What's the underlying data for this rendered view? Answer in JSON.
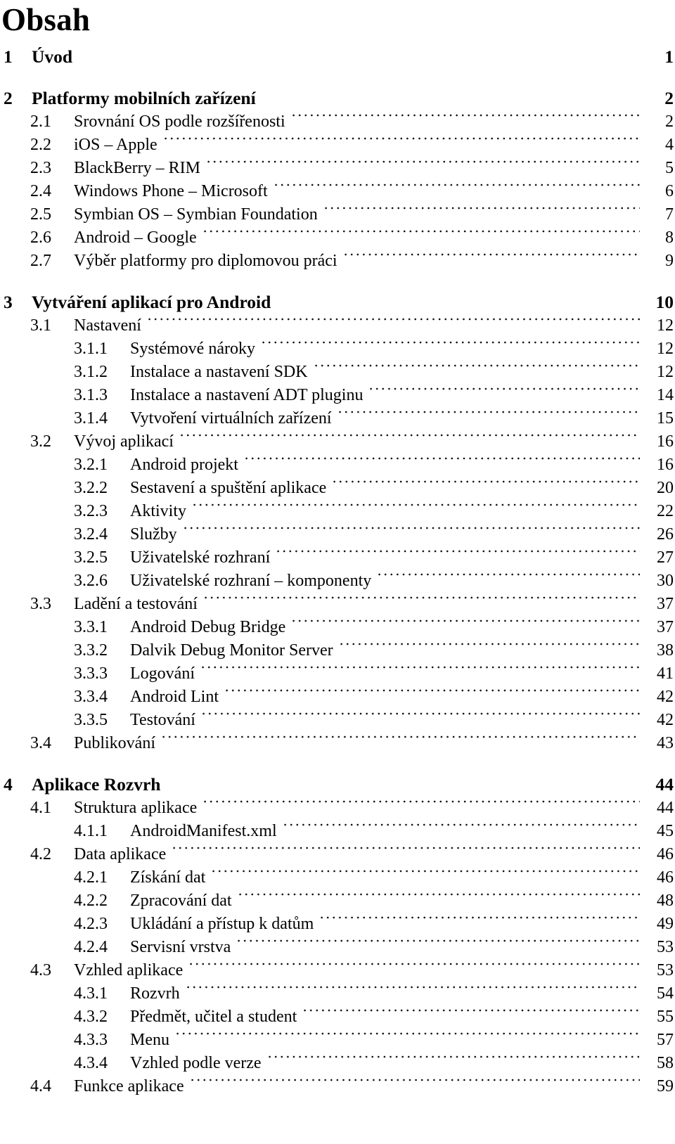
{
  "document": {
    "title": "Obsah",
    "language": "cs",
    "kind": "table-of-contents"
  },
  "toc": {
    "entries": [
      {
        "level": 1,
        "number": "1",
        "label": "Úvod",
        "page": "1",
        "leader": false
      },
      {
        "level": 1,
        "number": "2",
        "label": "Platformy mobilních zařízení",
        "page": "2",
        "leader": false
      },
      {
        "level": 2,
        "number": "2.1",
        "label": "Srovnání OS podle rozšířenosti",
        "page": "2",
        "leader": true
      },
      {
        "level": 2,
        "number": "2.2",
        "label": "iOS – Apple",
        "page": "4",
        "leader": true
      },
      {
        "level": 2,
        "number": "2.3",
        "label": "BlackBerry – RIM",
        "page": "5",
        "leader": true
      },
      {
        "level": 2,
        "number": "2.4",
        "label": "Windows Phone – Microsoft",
        "page": "6",
        "leader": true
      },
      {
        "level": 2,
        "number": "2.5",
        "label": "Symbian OS – Symbian Foundation",
        "page": "7",
        "leader": true
      },
      {
        "level": 2,
        "number": "2.6",
        "label": "Android – Google",
        "page": "8",
        "leader": true
      },
      {
        "level": 2,
        "number": "2.7",
        "label": "Výběr platformy pro diplomovou práci",
        "page": "9",
        "leader": true
      },
      {
        "level": 1,
        "number": "3",
        "label": "Vytváření aplikací pro Android",
        "page": "10",
        "leader": false
      },
      {
        "level": 2,
        "number": "3.1",
        "label": "Nastavení",
        "page": "12",
        "leader": true
      },
      {
        "level": 3,
        "number": "3.1.1",
        "label": "Systémové nároky",
        "page": "12",
        "leader": true
      },
      {
        "level": 3,
        "number": "3.1.2",
        "label": "Instalace a nastavení SDK",
        "page": "12",
        "leader": true
      },
      {
        "level": 3,
        "number": "3.1.3",
        "label": "Instalace a nastavení ADT pluginu",
        "page": "14",
        "leader": true
      },
      {
        "level": 3,
        "number": "3.1.4",
        "label": "Vytvoření virtuálních zařízení",
        "page": "15",
        "leader": true
      },
      {
        "level": 2,
        "number": "3.2",
        "label": "Vývoj aplikací",
        "page": "16",
        "leader": true
      },
      {
        "level": 3,
        "number": "3.2.1",
        "label": "Android projekt",
        "page": "16",
        "leader": true
      },
      {
        "level": 3,
        "number": "3.2.2",
        "label": "Sestavení a spuštění aplikace",
        "page": "20",
        "leader": true
      },
      {
        "level": 3,
        "number": "3.2.3",
        "label": "Aktivity",
        "page": "22",
        "leader": true
      },
      {
        "level": 3,
        "number": "3.2.4",
        "label": "Služby",
        "page": "26",
        "leader": true
      },
      {
        "level": 3,
        "number": "3.2.5",
        "label": "Uživatelské rozhraní",
        "page": "27",
        "leader": true
      },
      {
        "level": 3,
        "number": "3.2.6",
        "label": "Uživatelské rozhraní – komponenty",
        "page": "30",
        "leader": true
      },
      {
        "level": 2,
        "number": "3.3",
        "label": "Ladění a testování",
        "page": "37",
        "leader": true
      },
      {
        "level": 3,
        "number": "3.3.1",
        "label": "Android Debug Bridge",
        "page": "37",
        "leader": true
      },
      {
        "level": 3,
        "number": "3.3.2",
        "label": "Dalvik Debug Monitor Server",
        "page": "38",
        "leader": true
      },
      {
        "level": 3,
        "number": "3.3.3",
        "label": "Logování",
        "page": "41",
        "leader": true
      },
      {
        "level": 3,
        "number": "3.3.4",
        "label": "Android Lint",
        "page": "42",
        "leader": true
      },
      {
        "level": 3,
        "number": "3.3.5",
        "label": "Testování",
        "page": "42",
        "leader": true
      },
      {
        "level": 2,
        "number": "3.4",
        "label": "Publikování",
        "page": "43",
        "leader": true
      },
      {
        "level": 1,
        "number": "4",
        "label": "Aplikace Rozvrh",
        "page": "44",
        "leader": false
      },
      {
        "level": 2,
        "number": "4.1",
        "label": "Struktura aplikace",
        "page": "44",
        "leader": true
      },
      {
        "level": 3,
        "number": "4.1.1",
        "label": "AndroidManifest.xml",
        "page": "45",
        "leader": true
      },
      {
        "level": 2,
        "number": "4.2",
        "label": "Data aplikace",
        "page": "46",
        "leader": true
      },
      {
        "level": 3,
        "number": "4.2.1",
        "label": "Získání dat",
        "page": "46",
        "leader": true
      },
      {
        "level": 3,
        "number": "4.2.2",
        "label": "Zpracování dat",
        "page": "48",
        "leader": true
      },
      {
        "level": 3,
        "number": "4.2.3",
        "label": "Ukládání a přístup k datům",
        "page": "49",
        "leader": true
      },
      {
        "level": 3,
        "number": "4.2.4",
        "label": "Servisní vrstva",
        "page": "53",
        "leader": true
      },
      {
        "level": 2,
        "number": "4.3",
        "label": "Vzhled aplikace",
        "page": "53",
        "leader": true
      },
      {
        "level": 3,
        "number": "4.3.1",
        "label": "Rozvrh",
        "page": "54",
        "leader": true
      },
      {
        "level": 3,
        "number": "4.3.2",
        "label": "Předmět, učitel a student",
        "page": "55",
        "leader": true
      },
      {
        "level": 3,
        "number": "4.3.3",
        "label": "Menu",
        "page": "57",
        "leader": true
      },
      {
        "level": 3,
        "number": "4.3.4",
        "label": "Vzhled podle verze",
        "page": "58",
        "leader": true
      },
      {
        "level": 2,
        "number": "4.4",
        "label": "Funkce aplikace",
        "page": "59",
        "leader": true
      }
    ]
  }
}
